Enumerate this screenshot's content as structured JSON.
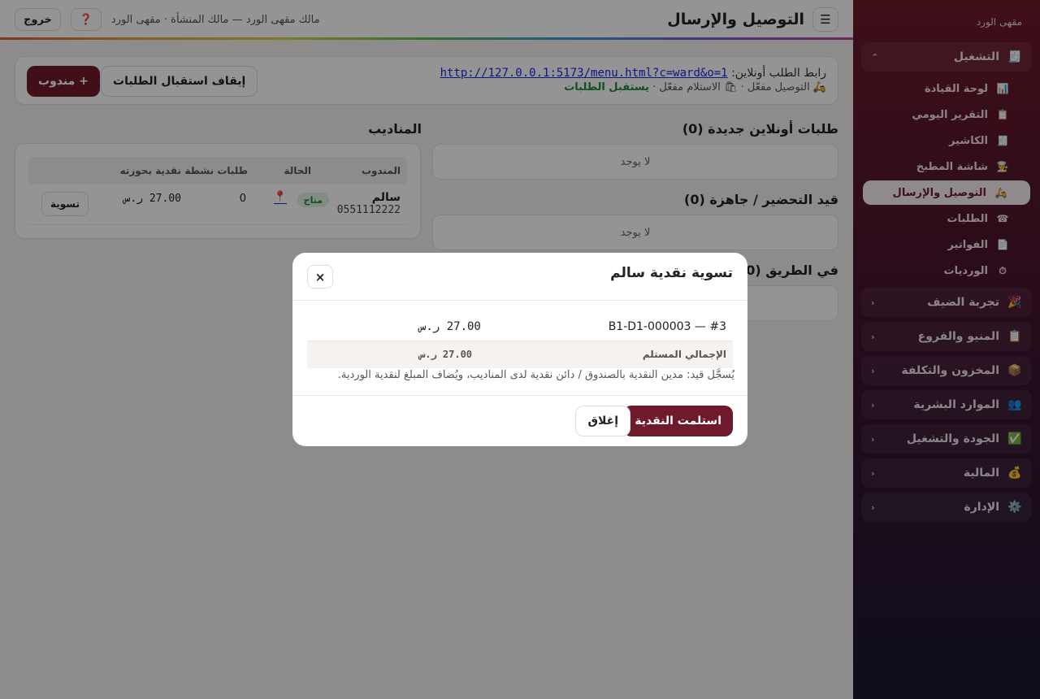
{
  "sidebar": {
    "brand": "مقهى الورد",
    "sections": [
      {
        "label": "التشغيل",
        "icon": "🧾",
        "chevron": "⌃",
        "open": true
      },
      {
        "label": "تجربة الضيف",
        "icon": "🎉",
        "chevron": "‹"
      },
      {
        "label": "المنيو والفروع",
        "icon": "📋",
        "chevron": "‹"
      },
      {
        "label": "المخزون والتكلفة",
        "icon": "📦",
        "chevron": "‹"
      },
      {
        "label": "الموارد البشرية",
        "icon": "👥",
        "chevron": "‹"
      },
      {
        "label": "الجودة والتشغيل",
        "icon": "✅",
        "chevron": "‹"
      },
      {
        "label": "المالية",
        "icon": "💰",
        "chevron": "‹"
      },
      {
        "label": "الإدارة",
        "icon": "⚙️",
        "chevron": "‹"
      }
    ],
    "items": [
      {
        "label": "لوحة القيادة",
        "icon": "📊"
      },
      {
        "label": "التقرير اليومي",
        "icon": "📋"
      },
      {
        "label": "الكاشير",
        "icon": "🧾"
      },
      {
        "label": "شاشة المطبخ",
        "icon": "👨‍🍳"
      },
      {
        "label": "التوصيل والإرسال",
        "icon": "🛵",
        "active": true
      },
      {
        "label": "الطلبات",
        "icon": "☎"
      },
      {
        "label": "الفواتير",
        "icon": "📄"
      },
      {
        "label": "الورديات",
        "icon": "⏱"
      }
    ]
  },
  "header": {
    "title": "التوصيل والإرسال",
    "menu_icon": "☰",
    "owner_info": "مالك مقهى الورد — مالك المنشأة · مقهى الورد",
    "help_icon": "❓",
    "logout_label": "خروج"
  },
  "panel": {
    "link_label": "رابط الطلب أونلاين:",
    "link_url": "http://127.0.0.1:5173/menu.html?c=ward&o=1",
    "status_prefix": "🛵 التوصيل مفعّل · 🛍 الاستلام مفعّل ·",
    "status_accepting": "يستقبل الطلبات",
    "stop_label": "إيقاف استقبال الطلبات",
    "add_driver_label": "+ مندوب"
  },
  "columns": {
    "new_online": "طلبات أونلاين جديدة (0)",
    "preparing": "قيد التحضير / جاهزة (0)",
    "on_way": "في الطريق (0)",
    "empty_text": "لا يوجد",
    "drivers_title": "المناديب"
  },
  "drivers_table": {
    "headers": [
      "المندوب",
      "الحالة",
      "طلبات نشطة",
      "نقدية بحوزته"
    ],
    "rows": [
      {
        "name": "سالم",
        "phone": "0551112222",
        "status": "متاح",
        "pin_icon": "📍",
        "active": "0",
        "cash": "27.00 ر.س",
        "action": "تسوية"
      }
    ]
  },
  "modal": {
    "title": "تسوية نقدية سالم",
    "close_icon": "×",
    "order_id": "#3 — B1-D1-000003",
    "order_amount": "27.00 ر.س",
    "total_label": "الإجمالي المستلم",
    "total_amount": "27.00 ر.س",
    "note": "يُسجَّل قيد: مدين النقدية بالصندوق / دائن نقدية لدى المناديب، ويُضاف المبلغ لنقدية الوردية.",
    "confirm_label": "استلمت النقدية",
    "close_label": "إغلاق"
  }
}
